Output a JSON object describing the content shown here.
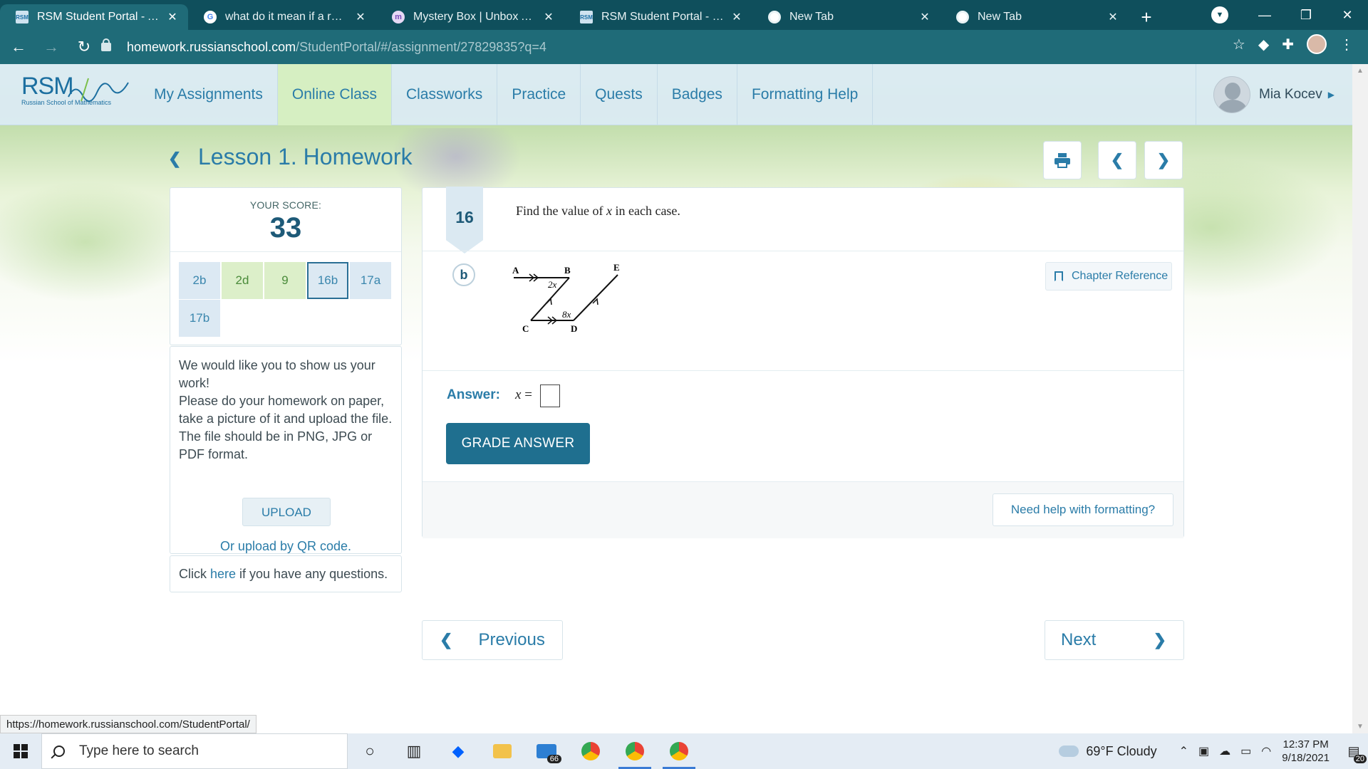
{
  "browser": {
    "tabs": [
      {
        "title": "RSM Student Portal - Assignments",
        "favicon": "rsm-icon",
        "active": true
      },
      {
        "title": "what do it mean if a relation is",
        "favicon": "google-icon",
        "active": false
      },
      {
        "title": "Mystery Box | Unbox Authentic",
        "favicon": "mysterybox-icon",
        "active": false
      },
      {
        "title": "RSM Student Portal - Online Class",
        "favicon": "rsm-icon",
        "active": false
      },
      {
        "title": "New Tab",
        "favicon": "chrome-icon",
        "active": false
      },
      {
        "title": "New Tab",
        "favicon": "chrome-icon",
        "active": false
      }
    ],
    "url_host": "homework.russianschool.com",
    "url_path": "/StudentPortal/#/assignment/27829835?q=4",
    "status_url": "https://homework.russianschool.com/StudentPortal/"
  },
  "site": {
    "logo_text": "RSM",
    "logo_subtext": "Russian School of Mathematics",
    "nav": [
      "My Assignments",
      "Online Class",
      "Classworks",
      "Practice",
      "Quests",
      "Badges",
      "Formatting Help"
    ],
    "active_nav": "Online Class",
    "user_name": "Mia Kocev"
  },
  "lesson": {
    "title": "Lesson 1. Homework"
  },
  "score": {
    "label": "YOUR SCORE:",
    "value": "33",
    "questions": [
      {
        "label": "2b",
        "state": "blue"
      },
      {
        "label": "2d",
        "state": "green"
      },
      {
        "label": "9",
        "state": "green"
      },
      {
        "label": "16b",
        "state": "active"
      },
      {
        "label": "17a",
        "state": "blue"
      },
      {
        "label": "17b",
        "state": "blue"
      }
    ]
  },
  "upload": {
    "line1": "We would like you to show us your work!",
    "line2": "Please do your homework on paper, take a picture of it and upload the file.",
    "line3": "The file should be in PNG, JPG or PDF format.",
    "button": "UPLOAD",
    "qr_link": "Or upload by QR code."
  },
  "questions_help": {
    "prefix": "Click",
    "link": "here",
    "suffix": "if you have any questions."
  },
  "problem": {
    "number": "16",
    "text_before": "Find the value of",
    "variable": "x",
    "text_after": "in each case.",
    "part": "b",
    "diagram_labels": {
      "a": "A",
      "b": "B",
      "c": "C",
      "d": "D",
      "e": "E",
      "angle1": "2x",
      "angle2": "8x"
    },
    "chapter_reference": "Chapter Reference",
    "answer_label": "Answer:",
    "answer_var": "x",
    "answer_eq": "=",
    "grade_button": "GRADE ANSWER",
    "help_button": "Need help with formatting?"
  },
  "pager": {
    "previous": "Previous",
    "next": "Next"
  },
  "taskbar": {
    "search_placeholder": "Type here to search",
    "mail_badge": "66",
    "weather": "69°F  Cloudy",
    "time": "12:37 PM",
    "date": "9/18/2021",
    "notif_count": "20"
  }
}
